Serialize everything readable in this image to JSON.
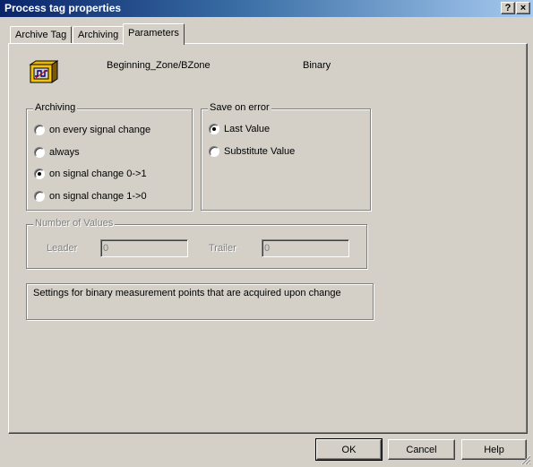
{
  "window": {
    "title": "Process tag properties",
    "help_glyph": "?",
    "close_glyph": "×"
  },
  "tabs": [
    {
      "label": "Archive Tag",
      "active": false
    },
    {
      "label": "Archiving",
      "active": false
    },
    {
      "label": "Parameters",
      "active": true
    }
  ],
  "tag": {
    "icon": "binary-tag-icon",
    "name": "Beginning_Zone/BZone",
    "type": "Binary"
  },
  "archiving": {
    "legend": "Archiving",
    "options": [
      {
        "label": "on every signal change",
        "checked": false
      },
      {
        "label": "always",
        "checked": false
      },
      {
        "label": "on signal change 0->1",
        "checked": true
      },
      {
        "label": "on signal change 1->0",
        "checked": false
      }
    ]
  },
  "save_on_error": {
    "legend": "Save on error",
    "options": [
      {
        "label": "Last Value",
        "checked": true
      },
      {
        "label": "Substitute Value",
        "checked": false
      }
    ]
  },
  "number_of_values": {
    "legend": "Number of Values",
    "disabled": true,
    "leader_label": "Leader",
    "leader_value": "0",
    "trailer_label": "Trailer",
    "trailer_value": "0"
  },
  "description": "Settings for binary measurement points that are acquired upon change",
  "buttons": {
    "ok": "OK",
    "cancel": "Cancel",
    "help": "Help"
  },
  "colors": {
    "face": "#d4d0c8",
    "title_start": "#0a246a",
    "title_end": "#a6caf0",
    "disabled_text": "#808080"
  }
}
